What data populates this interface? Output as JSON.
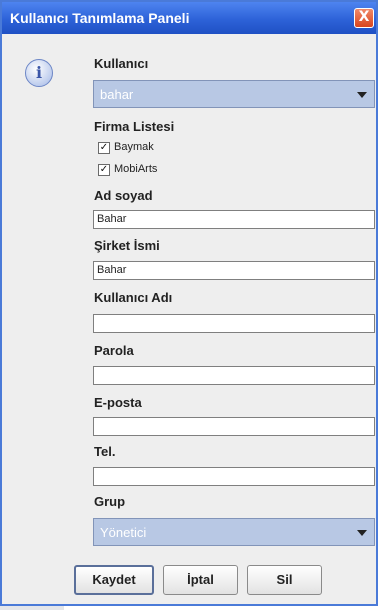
{
  "window": {
    "title": "Kullanıcı Tanımlama Paneli",
    "close_glyph": "X"
  },
  "info_icon": "info-icon",
  "user": {
    "label": "Kullanıcı",
    "selected": "bahar"
  },
  "companies": {
    "label": "Firma Listesi",
    "items": [
      {
        "label": "Baymak",
        "checked": true
      },
      {
        "label": "MobiArts",
        "checked": true
      }
    ]
  },
  "fields": {
    "fullname": {
      "label": "Ad soyad",
      "value": "Bahar"
    },
    "company": {
      "label": "Şirket İsmi",
      "value": "Bahar"
    },
    "username": {
      "label": "Kullanıcı Adı",
      "value": ""
    },
    "password": {
      "label": "Parola",
      "value": ""
    },
    "email": {
      "label": "E-posta",
      "value": ""
    },
    "phone": {
      "label": "Tel.",
      "value": ""
    }
  },
  "group": {
    "label": "Grup",
    "selected": "Yönetici"
  },
  "buttons": {
    "save": "Kaydet",
    "cancel": "İptal",
    "delete": "Sil"
  },
  "colors": {
    "title_bar": "#2d62d8",
    "combo_bg": "#b8c8e4",
    "dialog_bg": "#eeeeee",
    "close_button": "#d9451e"
  }
}
